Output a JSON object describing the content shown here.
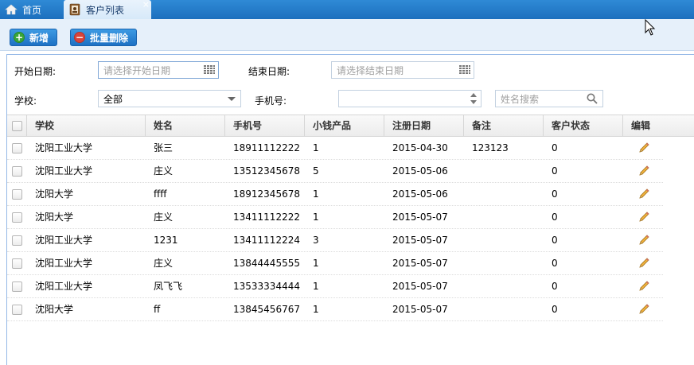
{
  "tabs": {
    "home_label": "首页",
    "active_label": "客户列表",
    "close_glyph": "×"
  },
  "toolbar": {
    "add_label": "新增",
    "batch_delete_label": "批量删除"
  },
  "filters": {
    "start_date_label": "开始日期:",
    "start_date_placeholder": "请选择开始日期",
    "end_date_label": "结束日期:",
    "end_date_placeholder": "请选择结束日期",
    "school_label": "学校:",
    "school_value": "全部",
    "phone_label": "手机号:",
    "phone_value": "",
    "name_search_placeholder": "姓名搜索"
  },
  "grid": {
    "columns": [
      "学校",
      "姓名",
      "手机号",
      "小钱产品",
      "注册日期",
      "备注",
      "客户状态",
      "编辑"
    ],
    "rows": [
      [
        "沈阳工业大学",
        "张三",
        "18911112222",
        "1",
        "2015-04-30",
        "123123",
        "0"
      ],
      [
        "沈阳工业大学",
        "庄义",
        "13512345678",
        "5",
        "2015-05-06",
        "",
        "0"
      ],
      [
        "沈阳大学",
        "ffff",
        "18912345678",
        "1",
        "2015-05-06",
        "",
        "0"
      ],
      [
        "沈阳大学",
        "庄义",
        "13411112222",
        "1",
        "2015-05-07",
        "",
        "0"
      ],
      [
        "沈阳工业大学",
        "1231",
        "13411112224",
        "3",
        "2015-05-07",
        "",
        "0"
      ],
      [
        "沈阳工业大学",
        "庄义",
        "13844445555",
        "1",
        "2015-05-07",
        "",
        "0"
      ],
      [
        "沈阳工业大学",
        "凤飞飞",
        "13533334444",
        "1",
        "2015-05-07",
        "",
        "0"
      ],
      [
        "沈阳大学",
        "ff",
        "13845456767",
        "1",
        "2015-05-07",
        "",
        "0"
      ]
    ]
  },
  "colors": {
    "tabbar": "#1c6fbe",
    "toolbar_bg": "#e6f0fa",
    "add_icon": "#3aa63a",
    "delete_icon": "#d9443b",
    "panel_border": "#95b8e7"
  },
  "icons": {
    "home": "home-icon",
    "customer_tab": "contact-card-icon",
    "add": "plus-circle-icon",
    "delete": "minus-circle-icon",
    "calendar": "calendar-icon",
    "search": "search-icon",
    "edit": "pencil-icon"
  }
}
